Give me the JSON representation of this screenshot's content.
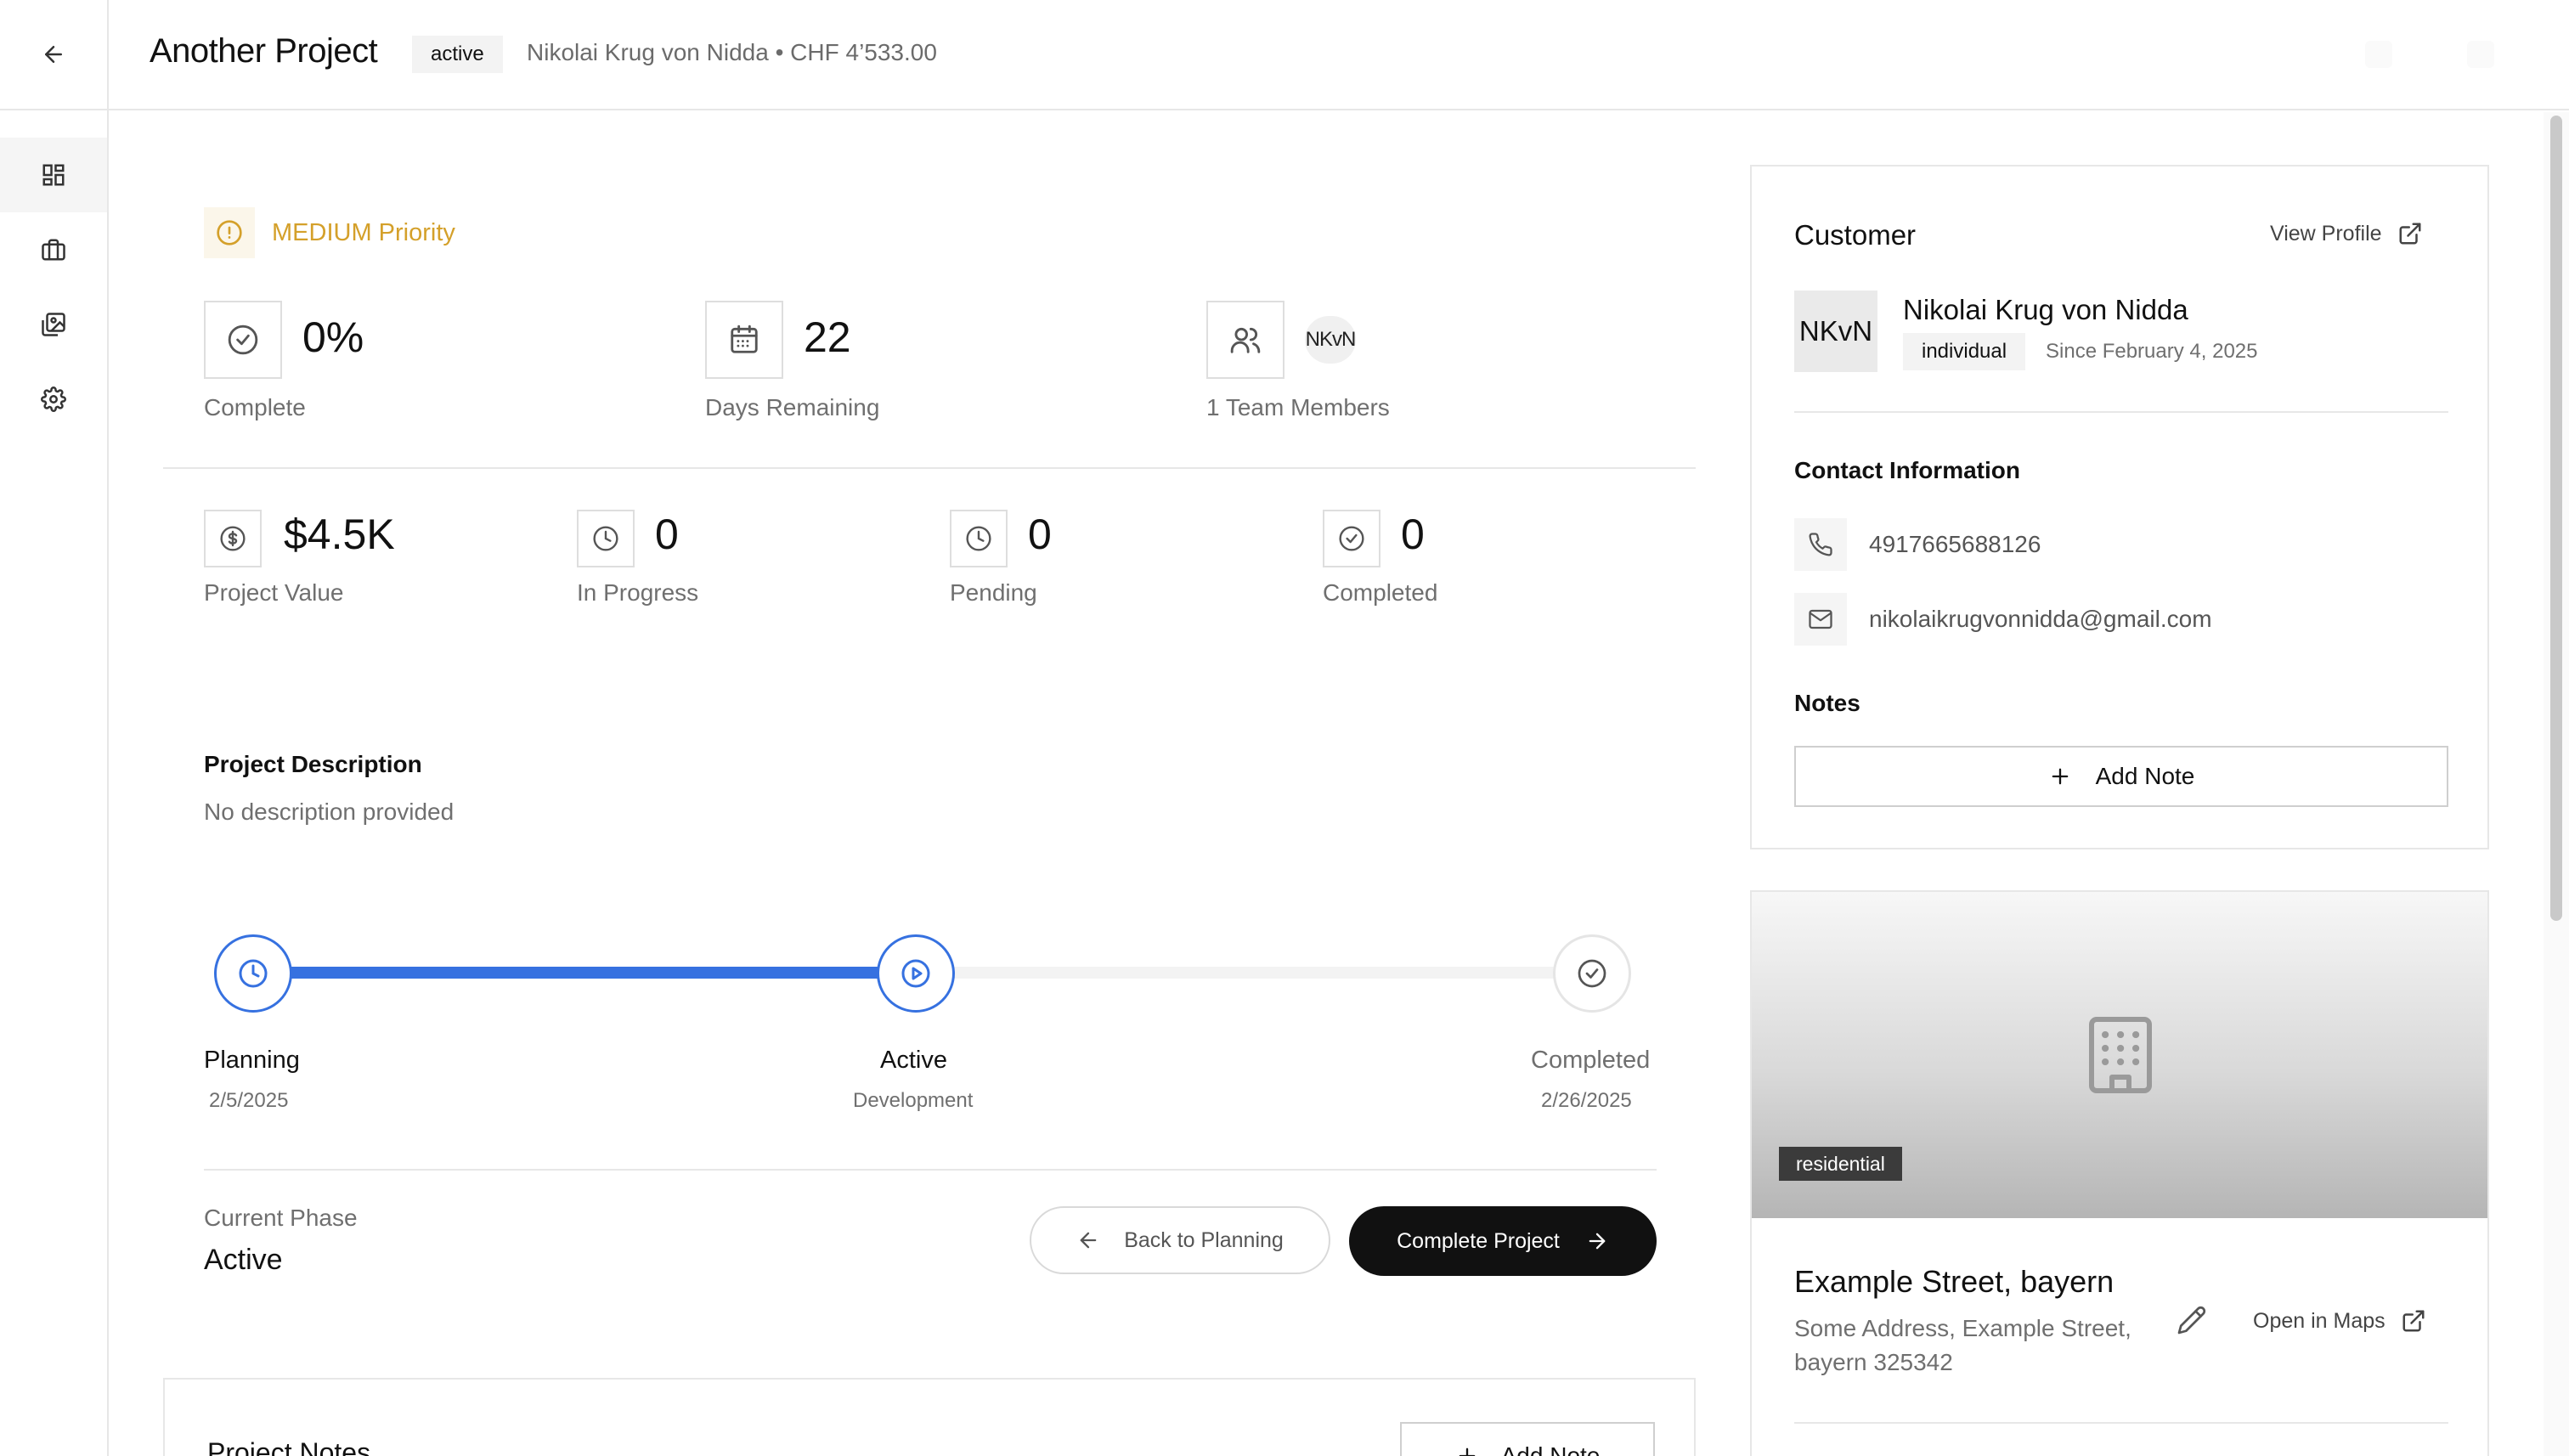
{
  "header": {
    "title": "Another Project",
    "status": "active",
    "subtitle": "Nikolai Krug von Nidda • CHF 4’533.00"
  },
  "sidebar": {
    "items": [
      {
        "name": "dashboard",
        "icon": "dashboard-icon",
        "active": true
      },
      {
        "name": "projects",
        "icon": "briefcase-icon",
        "active": false
      },
      {
        "name": "gallery",
        "icon": "images-icon",
        "active": false
      },
      {
        "name": "settings",
        "icon": "gear-icon",
        "active": false
      }
    ]
  },
  "priority": {
    "label": "MEDIUM Priority",
    "color": "#d4a02a"
  },
  "stats_top": {
    "complete": {
      "value": "0%",
      "label": "Complete"
    },
    "days": {
      "value": "22",
      "label": "Days Remaining"
    },
    "team": {
      "avatar": "NKvN",
      "label": "1 Team Members"
    }
  },
  "stats_bottom": {
    "value": {
      "value": "$4.5K",
      "label": "Project Value"
    },
    "in_progress": {
      "value": "0",
      "label": "In Progress"
    },
    "pending": {
      "value": "0",
      "label": "Pending"
    },
    "completed": {
      "value": "0",
      "label": "Completed"
    }
  },
  "description": {
    "title": "Project Description",
    "text": "No description provided"
  },
  "timeline": {
    "progress_fraction": 0.5,
    "accent": "#3671e0",
    "phases": [
      {
        "name": "Planning",
        "sub": "2/5/2025"
      },
      {
        "name": "Active",
        "sub": "Development"
      },
      {
        "name": "Completed",
        "sub": "2/26/2025"
      }
    ]
  },
  "current_phase": {
    "label": "Current Phase",
    "value": "Active"
  },
  "actions": {
    "back": "Back to Planning",
    "complete": "Complete Project"
  },
  "project_notes": {
    "title": "Project Notes",
    "add": "Add Note"
  },
  "customer": {
    "title": "Customer",
    "view_profile": "View Profile",
    "initials": "NKvN",
    "name": "Nikolai Krug von Nidda",
    "type": "individual",
    "since": "Since February 4, 2025",
    "contact_title": "Contact Information",
    "phone": "4917665688126",
    "email": "nikolaikrugvonnidda@gmail.com",
    "notes_title": "Notes",
    "add_note": "Add Note"
  },
  "property": {
    "badge": "residential",
    "title": "Example Street, bayern",
    "address": "Some Address, Example Street, bayern 325342",
    "open_maps": "Open in Maps"
  }
}
